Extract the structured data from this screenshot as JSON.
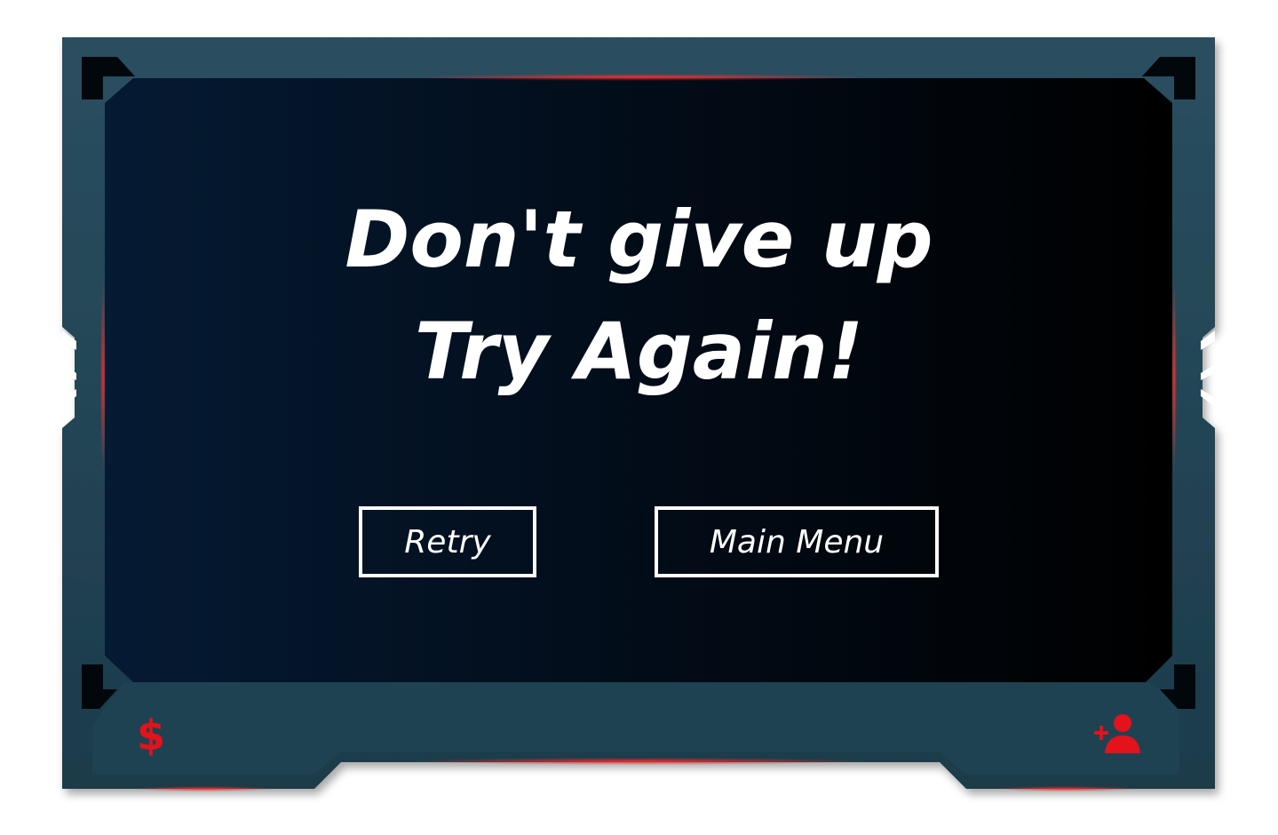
{
  "screen": {
    "headline_line1": "Don't give up",
    "headline_line2": "Try Again!"
  },
  "buttons": {
    "retry_label": "Retry",
    "main_menu_label": "Main Menu"
  },
  "footer": {
    "currency_symbol": "$",
    "left_icon": "currency-icon",
    "right_icon": "add-user-icon"
  },
  "colors": {
    "frame": "#244858",
    "frame_dark": "#1b3a49",
    "panel_left": "#04152a",
    "panel_right": "#000000",
    "accent_red": "#e3121b",
    "text": "#ffffff"
  }
}
